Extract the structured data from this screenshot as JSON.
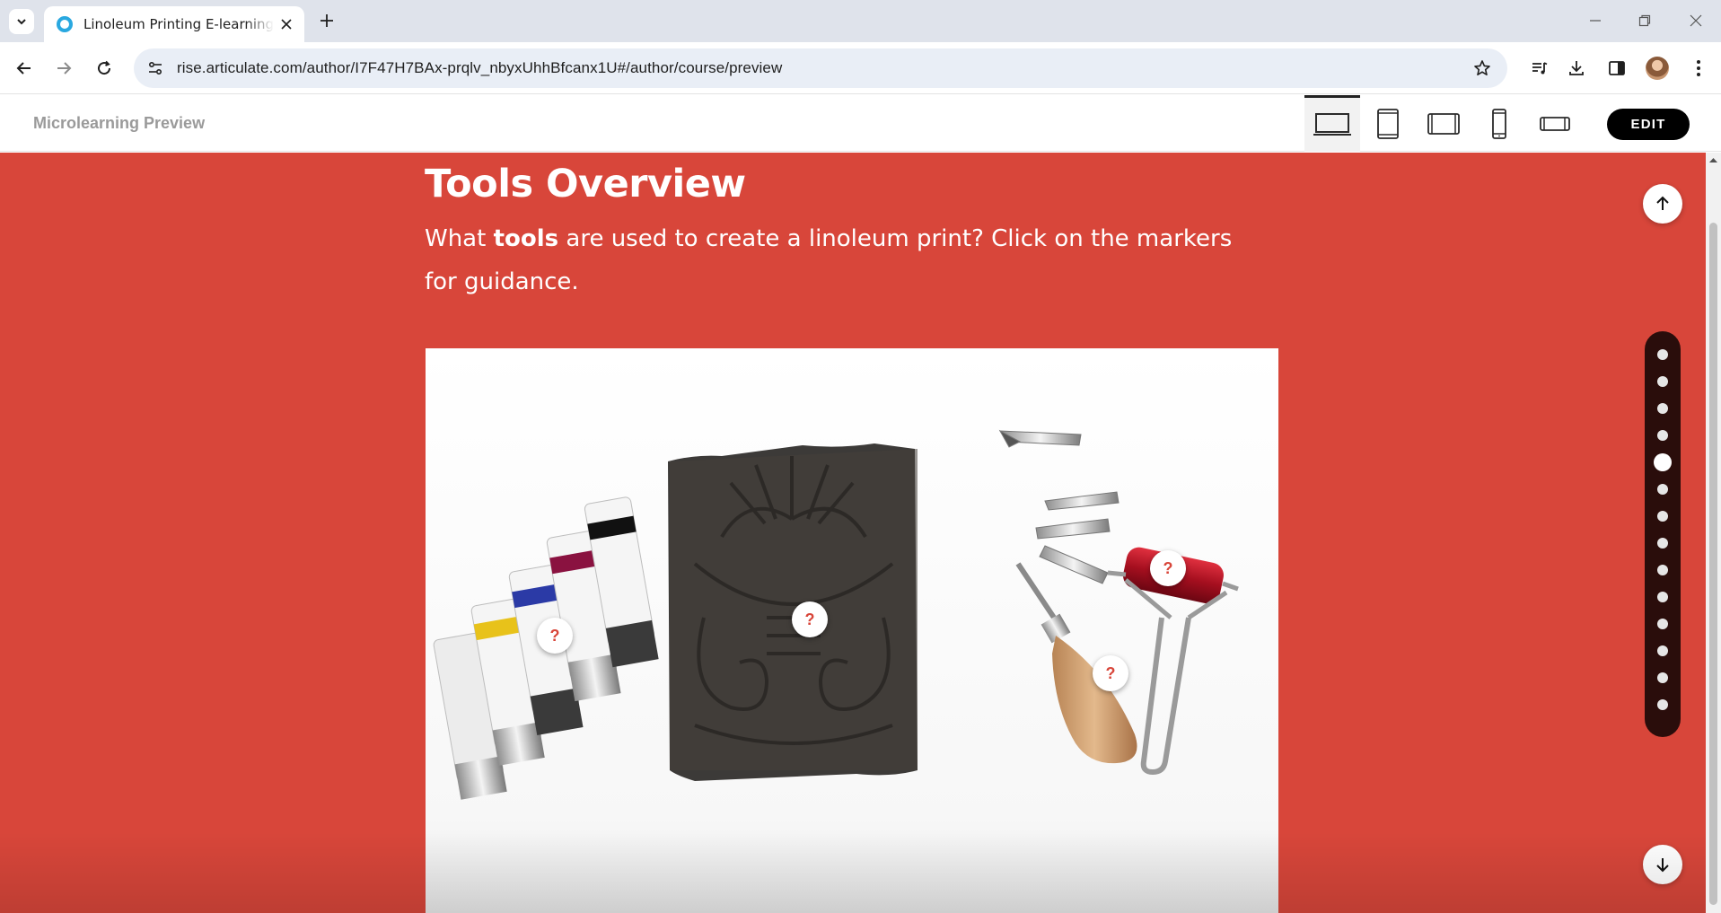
{
  "browser": {
    "tab_title": "Linoleum Printing E-learning Gu",
    "url": "rise.articulate.com/author/I7F47H7BAx-prqlv_nbyxUhhBfcanx1U#/author/course/preview"
  },
  "rise": {
    "header_title": "Microlearning Preview",
    "edit_label": "EDIT",
    "devices": [
      "desktop-icon",
      "tablet-portrait-icon",
      "tablet-landscape-icon",
      "phone-portrait-icon",
      "phone-landscape-icon"
    ],
    "active_device": "desktop"
  },
  "lesson": {
    "heading": "Tools Overview",
    "sub_prefix": "What ",
    "sub_bold": "tools",
    "sub_suffix": " are used to create a linoleum print? Click on the markers for guidance."
  },
  "markers": [
    "?",
    "?",
    "?",
    "?"
  ],
  "colors": {
    "lesson_bg": "#d8463a",
    "marker_glyph": "#d8463a",
    "rail_bg": "#2a0d0b",
    "edit_bg": "#000000",
    "favicon": "#29a8e0"
  },
  "progress": {
    "total_sections": 14,
    "active_section": 5
  }
}
